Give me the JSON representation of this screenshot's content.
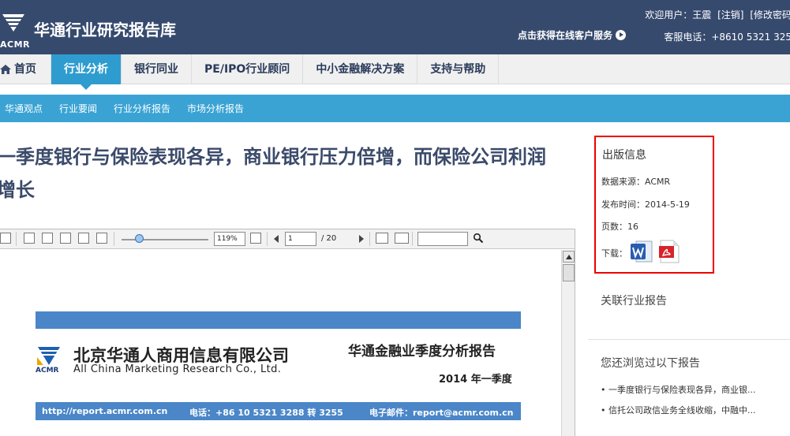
{
  "header": {
    "logo_text": "ACMR",
    "site_title": "华通行业研究报告库",
    "welcome": "欢迎用户：王震",
    "logout": "[注销]",
    "change_password": "[修改密码",
    "online_service": "点击获得在线客户服务",
    "service_phone": "客服电话：+8610 5321 325"
  },
  "nav": {
    "items": [
      {
        "label": "首页"
      },
      {
        "label": "行业分析"
      },
      {
        "label": "银行同业"
      },
      {
        "label": "PE/IPO行业顾问"
      },
      {
        "label": "中小金融解决方案"
      },
      {
        "label": "支持与帮助"
      }
    ],
    "active_index": 1
  },
  "subnav": {
    "items": [
      {
        "label": "华通观点"
      },
      {
        "label": "行业要闻"
      },
      {
        "label": "行业分析报告"
      },
      {
        "label": "市场分析报告"
      }
    ]
  },
  "article": {
    "title_line1": "一季度银行与保险表现各异，商业银行压力倍增，而保险公司利润",
    "title_line2": "增长"
  },
  "viewer": {
    "zoom": "119%",
    "current_page": "1",
    "total_pages": "/  20",
    "search_value": ""
  },
  "document": {
    "logo_text": "ACMR",
    "company_cn": "北京华通人商用信息有限公司",
    "company_en": "All China Marketing Research Co., Ltd.",
    "report_title": "华通金融业季度分析报告",
    "period": "2014 年一季度",
    "footer_url": "http://report.acmr.com.cn",
    "footer_phone": "电话：+86 10 5321 3288  转  3255",
    "footer_email": "电子邮件：report@acmr.com.cn"
  },
  "sidebar": {
    "pub_heading": "出版信息",
    "source": "数据来源：ACMR",
    "publish_time": "发布时间：2014-5-19",
    "pages": "页数：16",
    "download_label": "下载：",
    "related_heading": "关联行业报告",
    "viewed_heading": "您还浏览过以下报告",
    "viewed_items": [
      {
        "label": "• 一季度银行与保险表现各异，商业银..."
      },
      {
        "label": "• 信托公司政信业务全线收缩，中融中..."
      }
    ]
  },
  "colors": {
    "header_bg": "#364a6e",
    "accent_blue": "#2e9ccf",
    "subnav_bg": "#3aa3d4",
    "highlight_border": "#e00000"
  }
}
